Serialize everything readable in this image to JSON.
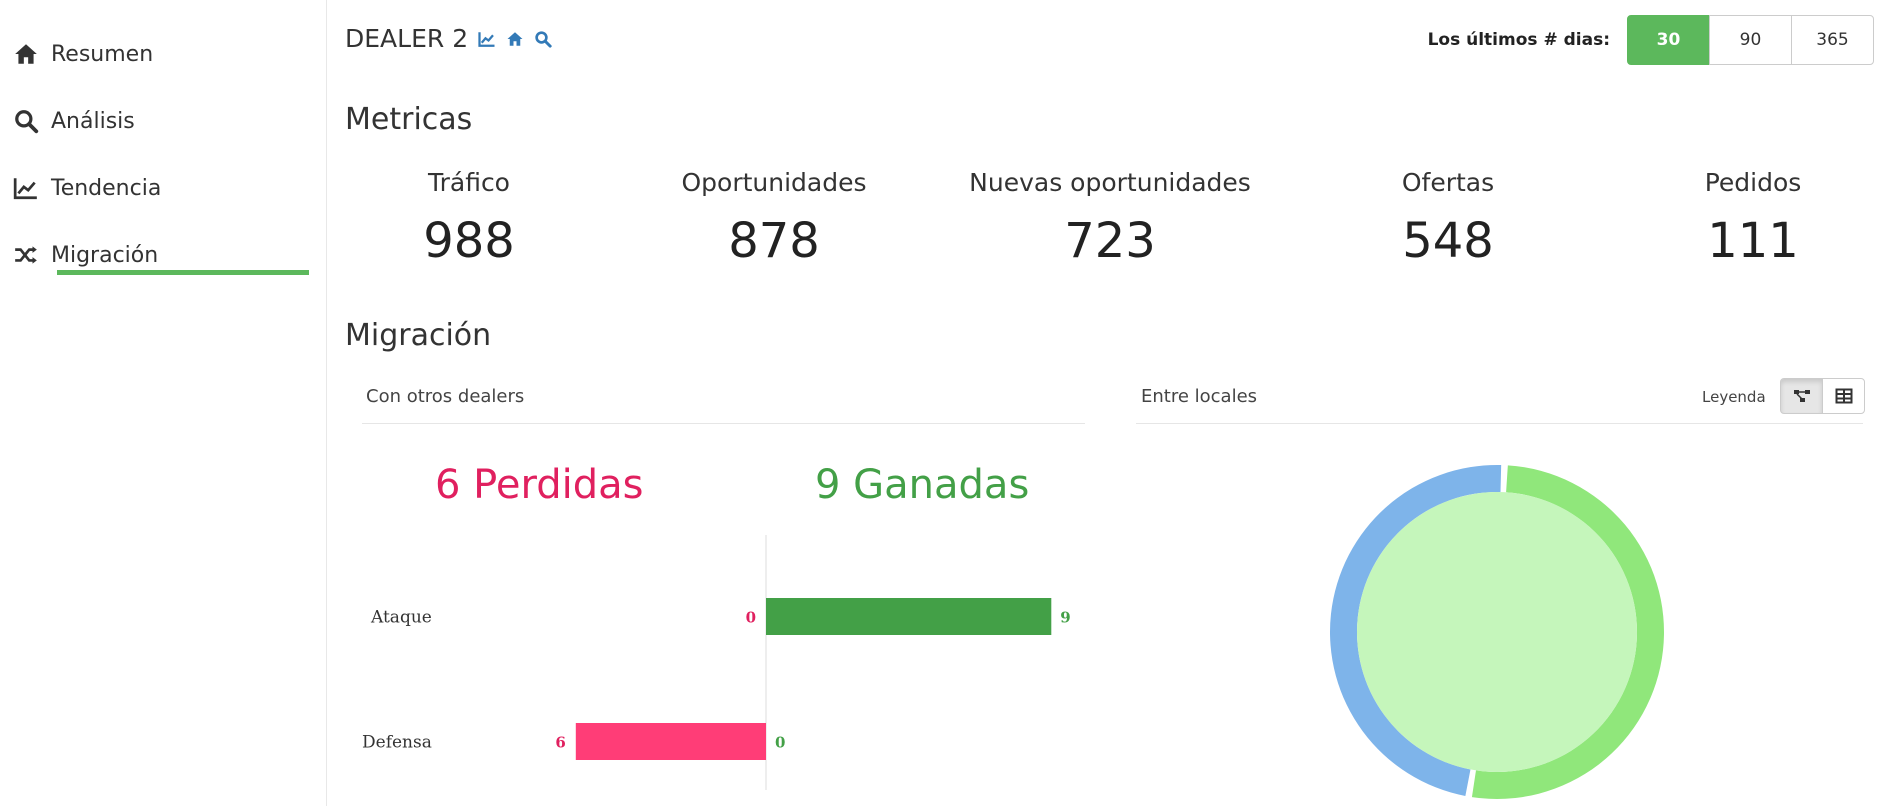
{
  "sidebar": {
    "items": [
      {
        "label": "Resumen",
        "icon": "home-icon"
      },
      {
        "label": "Análisis",
        "icon": "search-icon"
      },
      {
        "label": "Tendencia",
        "icon": "line-chart-icon"
      },
      {
        "label": "Migración",
        "icon": "random-icon",
        "active": true
      }
    ]
  },
  "header": {
    "title": "DEALER 2",
    "days_label": "Los últimos # dias:",
    "day_options": [
      "30",
      "90",
      "365"
    ],
    "selected_days": "30"
  },
  "metrics": {
    "section_title": "Metricas",
    "items": [
      {
        "label": "Tráfico",
        "value": "988"
      },
      {
        "label": "Oportunidades",
        "value": "878"
      },
      {
        "label": "Nuevas oportunidades",
        "value": "723"
      },
      {
        "label": "Ofertas",
        "value": "548"
      },
      {
        "label": "Pedidos",
        "value": "111"
      }
    ]
  },
  "migration": {
    "section_title": "Migración",
    "dealers_panel": {
      "title": "Con otros dealers",
      "lost_label": "6 Perdidas",
      "won_label": "9 Ganadas"
    },
    "locales_panel": {
      "title": "Entre locales",
      "legend_label": "Leyenda"
    }
  },
  "colors": {
    "accent_green": "#5cb85c",
    "won_green": "#43a047",
    "lost_pink": "#ff3d77",
    "lost_text": "#e0205f",
    "donut_blue": "#7eb4ea",
    "donut_green": "#90e77b",
    "donut_inner": "#c5f6bb",
    "link_blue": "#337ab7"
  },
  "chart_data": [
    {
      "type": "bar",
      "orientation": "horizontal-diverging",
      "categories": [
        "Ataque",
        "Defensa"
      ],
      "series": [
        {
          "name": "Perdidas",
          "values": [
            0,
            6
          ],
          "color": "#ff3d77"
        },
        {
          "name": "Ganadas",
          "values": [
            9,
            0
          ],
          "color": "#43a047"
        }
      ]
    },
    {
      "type": "pie",
      "style": "donut",
      "slices": [
        {
          "value": 0.48,
          "color": "#7eb4ea"
        },
        {
          "value": 0.52,
          "color": "#90e77b"
        }
      ],
      "inner_color": "#c5f6bb"
    }
  ]
}
